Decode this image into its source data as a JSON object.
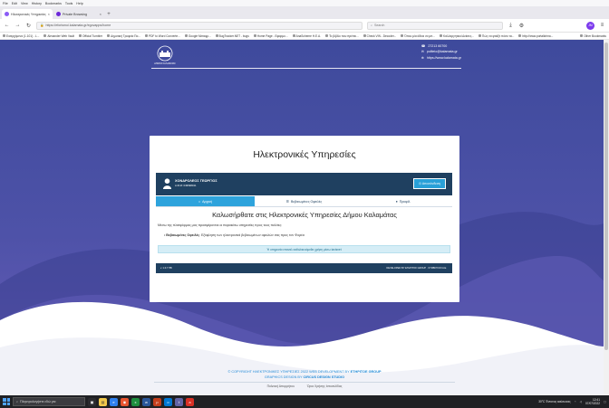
{
  "browser": {
    "menu": [
      "File",
      "Edit",
      "View",
      "History",
      "Bookmarks",
      "Tools",
      "Help"
    ],
    "tabs": [
      {
        "title": "Ηλεκτρονικές Υπηρεσίες",
        "active": true
      },
      {
        "title": "Private Browsing",
        "active": false
      }
    ],
    "new_tab": "+",
    "url": "https://eforismoi.kalamata.gr/egovapps/home",
    "search_placeholder": "Search",
    "profile": "JM",
    "bookmarks": [
      "Εισερχόμενα (1.101) - L...",
      "Alexander Web Vault",
      "Official Tumbler",
      "Δημοτική Τροφεία Πα...",
      "PDF to Word Converte...",
      "Google Μεταφρ...",
      "BugTracker.NET - bugs",
      "Home Page - Εφαρμο...",
      "AnaScheme H.E.A.",
      "Το βιβλίο που πρέπει...",
      "Check VIN - Decoder...",
      "Όπου μία άδεια να μπ...",
      "Καλλιεργητικοί Δείκτες...",
      "Πώς να φτιάξε πόσο τα...",
      "http://www.portalkrima...",
      "Other Bookmarks"
    ]
  },
  "site": {
    "logo_text": "ΔΗΜΟΣ ΚΑΛΑΜΑΤΑΣ",
    "contact": {
      "phone": "27213 60700",
      "email": "politeio@kalamata.gr",
      "web": "https://www.kalamata.gr"
    },
    "title": "Ηλεκτρονικές Υπηρεσίες",
    "user": {
      "name": "ΧΟΝΔΡΟΛΕΟΣ ΓΕΩΡΓΙΟΣ",
      "file": "Α.Φ.Μ: 049598431",
      "logout": "Αποσύνδεση"
    },
    "tabs": [
      {
        "label": "Αρχική",
        "active": true
      },
      {
        "label": "Βεβαιωμένες Οφειλές",
        "active": false
      },
      {
        "label": "Προφίλ",
        "active": false
      }
    ],
    "welcome": "Καλωσήρθατε στις Ηλεκτρονικές Υπηρεσίες Δήμου Καλαμάτας",
    "intro": "Μέσω της πλατφόρμας μας προσφέρονται οι παρακάτω υπηρεσίες προς τους πολίτες:",
    "service_name": "Βεβαιωμένες Οφειλές",
    "service_desc": ": Εξόφληση των ηλεκτρονικά βεβαιωμένων οφειλών σας προς τον Φορέα",
    "notice": "Ή υπηρεσία επαναλ καθολικευόμεθα χρήση μέσω taxisnet",
    "card_footer_left": "v. 1.0.7 ΠΒ",
    "card_footer_right": "DEVELOPED BY   ΕΤΗΡΙΤΟΣ GROUP · ΣΥΜΒΟΥΛΟΙ Α.Ε.",
    "copyright_line1": "© COPYRIGHT ΗΛΕΚΤΡΟΝΙΚΕΣ ΥΠΗΡΕΣΙΕΣ 2022 WEB DEVELOPMENT BY",
    "copyright_brand": "ETHPITOE GROUP",
    "graphics_line": "GRAPHICS DESIGN BY",
    "graphics_brand": "CIRCUS DESIGN STUDIO",
    "footer_links": [
      "Πολιτική Απορρήτου",
      "Όροι Χρήσης Ιστοσελίδας"
    ]
  },
  "taskbar": {
    "search_placeholder": "Πληκτρολογήστε εδώ για",
    "weather": "30°C  Έντονος καύσωνας",
    "time": "12:41",
    "date": "07/07/2022"
  }
}
